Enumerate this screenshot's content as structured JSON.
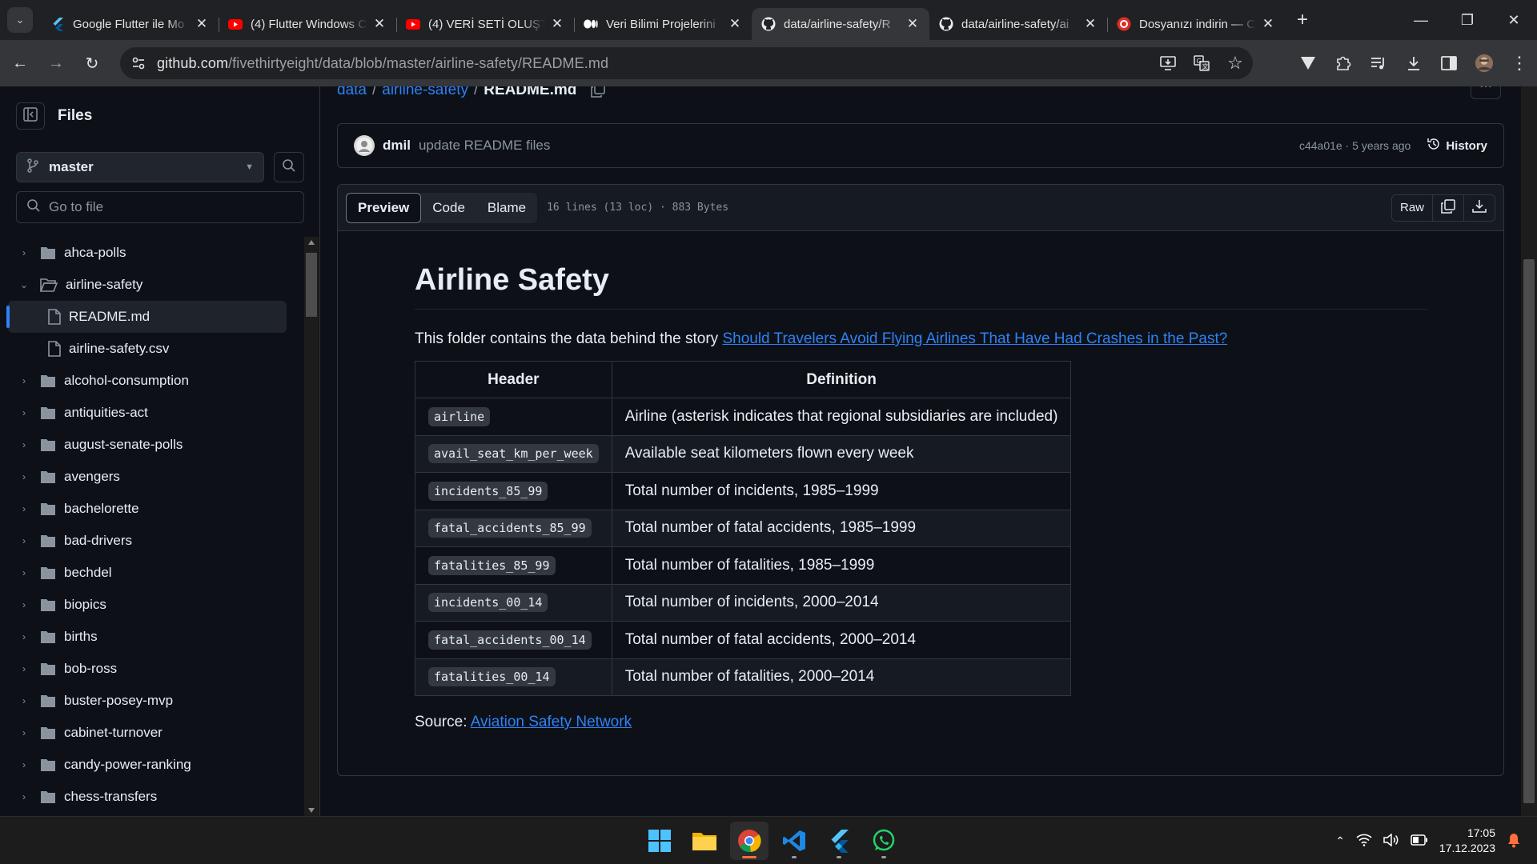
{
  "browser": {
    "tabs": [
      {
        "title": "Google Flutter ile Mo",
        "icon": "flutter-favicon",
        "active": false
      },
      {
        "title": "(4) Flutter Windows C",
        "icon": "youtube-favicon",
        "active": false
      },
      {
        "title": "(4) VERİ SETİ OLUŞTU",
        "icon": "youtube-favicon",
        "active": false
      },
      {
        "title": "Veri Bilimi Projelerini",
        "icon": "medium-favicon",
        "active": false
      },
      {
        "title": "data/airline-safety/R",
        "icon": "github-favicon",
        "active": true
      },
      {
        "title": "data/airline-safety/ai",
        "icon": "github-favicon",
        "active": false
      },
      {
        "title": "Dosyanızı indirin — C",
        "icon": "download-favicon",
        "active": false
      }
    ],
    "url_host": "github.com",
    "url_path": "/fivethirtyeight/data/blob/master/airline-safety/README.md"
  },
  "sidebar": {
    "title": "Files",
    "branch": "master",
    "goto_placeholder": "Go to file",
    "items": [
      {
        "label": "ahca-polls",
        "type": "folder",
        "expanded": false
      },
      {
        "label": "airline-safety",
        "type": "folder",
        "expanded": true
      },
      {
        "label": "README.md",
        "type": "file",
        "selected": true
      },
      {
        "label": "airline-safety.csv",
        "type": "file"
      },
      {
        "label": "alcohol-consumption",
        "type": "folder"
      },
      {
        "label": "antiquities-act",
        "type": "folder"
      },
      {
        "label": "august-senate-polls",
        "type": "folder"
      },
      {
        "label": "avengers",
        "type": "folder"
      },
      {
        "label": "bachelorette",
        "type": "folder"
      },
      {
        "label": "bad-drivers",
        "type": "folder"
      },
      {
        "label": "bechdel",
        "type": "folder"
      },
      {
        "label": "biopics",
        "type": "folder"
      },
      {
        "label": "births",
        "type": "folder"
      },
      {
        "label": "bob-ross",
        "type": "folder"
      },
      {
        "label": "buster-posey-mvp",
        "type": "folder"
      },
      {
        "label": "cabinet-turnover",
        "type": "folder"
      },
      {
        "label": "candy-power-ranking",
        "type": "folder"
      },
      {
        "label": "chess-transfers",
        "type": "folder"
      }
    ]
  },
  "breadcrumb": {
    "root": "data",
    "folder": "airline-safety",
    "file": "README.md"
  },
  "commit": {
    "author": "dmil",
    "message": "update README files",
    "meta": "c44a01e · 5 years ago",
    "history_label": "History"
  },
  "filebar": {
    "tabs": [
      "Preview",
      "Code",
      "Blame"
    ],
    "active_tab": "Preview",
    "info": "16 lines (13 loc) · 883 Bytes",
    "raw_label": "Raw"
  },
  "readme": {
    "title": "Airline Safety",
    "intro_text": "This folder contains the data behind the story ",
    "intro_link": "Should Travelers Avoid Flying Airlines That Have Had Crashes in the Past?",
    "table_headers": [
      "Header",
      "Definition"
    ],
    "rows": [
      [
        "airline",
        "Airline (asterisk indicates that regional subsidiaries are included)"
      ],
      [
        "avail_seat_km_per_week",
        "Available seat kilometers flown every week"
      ],
      [
        "incidents_85_99",
        "Total number of incidents, 1985–1999"
      ],
      [
        "fatal_accidents_85_99",
        "Total number of fatal accidents, 1985–1999"
      ],
      [
        "fatalities_85_99",
        "Total number of fatalities, 1985–1999"
      ],
      [
        "incidents_00_14",
        "Total number of incidents, 2000–2014"
      ],
      [
        "fatal_accidents_00_14",
        "Total number of fatal accidents, 2000–2014"
      ],
      [
        "fatalities_00_14",
        "Total number of fatalities, 2000–2014"
      ]
    ],
    "source_label": "Source: ",
    "source_link": "Aviation Safety Network"
  },
  "taskbar": {
    "apps": [
      "windows-start-icon",
      "file-explorer-icon",
      "chrome-icon",
      "vscode-icon",
      "flutter-icon",
      "whatsapp-icon"
    ],
    "time": "17:05",
    "date": "17.12.2023"
  },
  "colors": {
    "link": "#2f81f7",
    "background": "#0d1117",
    "border": "#30363d"
  }
}
